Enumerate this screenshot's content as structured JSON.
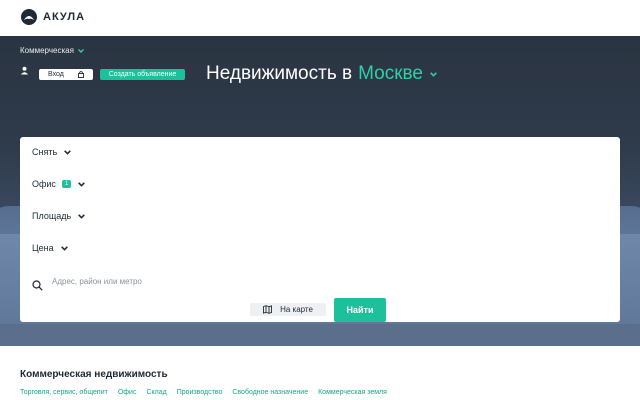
{
  "brand": {
    "name": "АКУЛА",
    "logo_icon": "shark-logo-icon"
  },
  "colors": {
    "accent": "#1cc09a",
    "accent_text": "#2fd0a8",
    "hero_dark": "#2a3441",
    "text_dark": "#1f2a37"
  },
  "hero": {
    "category": "Коммерческая",
    "login_label": "Вход",
    "create_label": "Создать объявление",
    "headline": "Недвижимость в",
    "city": "Москве"
  },
  "search": {
    "deal_type": "Снять",
    "property_type": "Офис",
    "property_type_count": "1",
    "area_label": "Площадь",
    "price_label": "Цена",
    "address_placeholder": "Адрес, район или метро",
    "map_label": "На карте",
    "find_label": "Найти"
  },
  "section": {
    "title": "Коммерческая недвижимость",
    "links": [
      "Торговля, сервис, общепит",
      "Офис",
      "Склад",
      "Производство",
      "Свободное назначение",
      "Коммерческая земля"
    ]
  }
}
